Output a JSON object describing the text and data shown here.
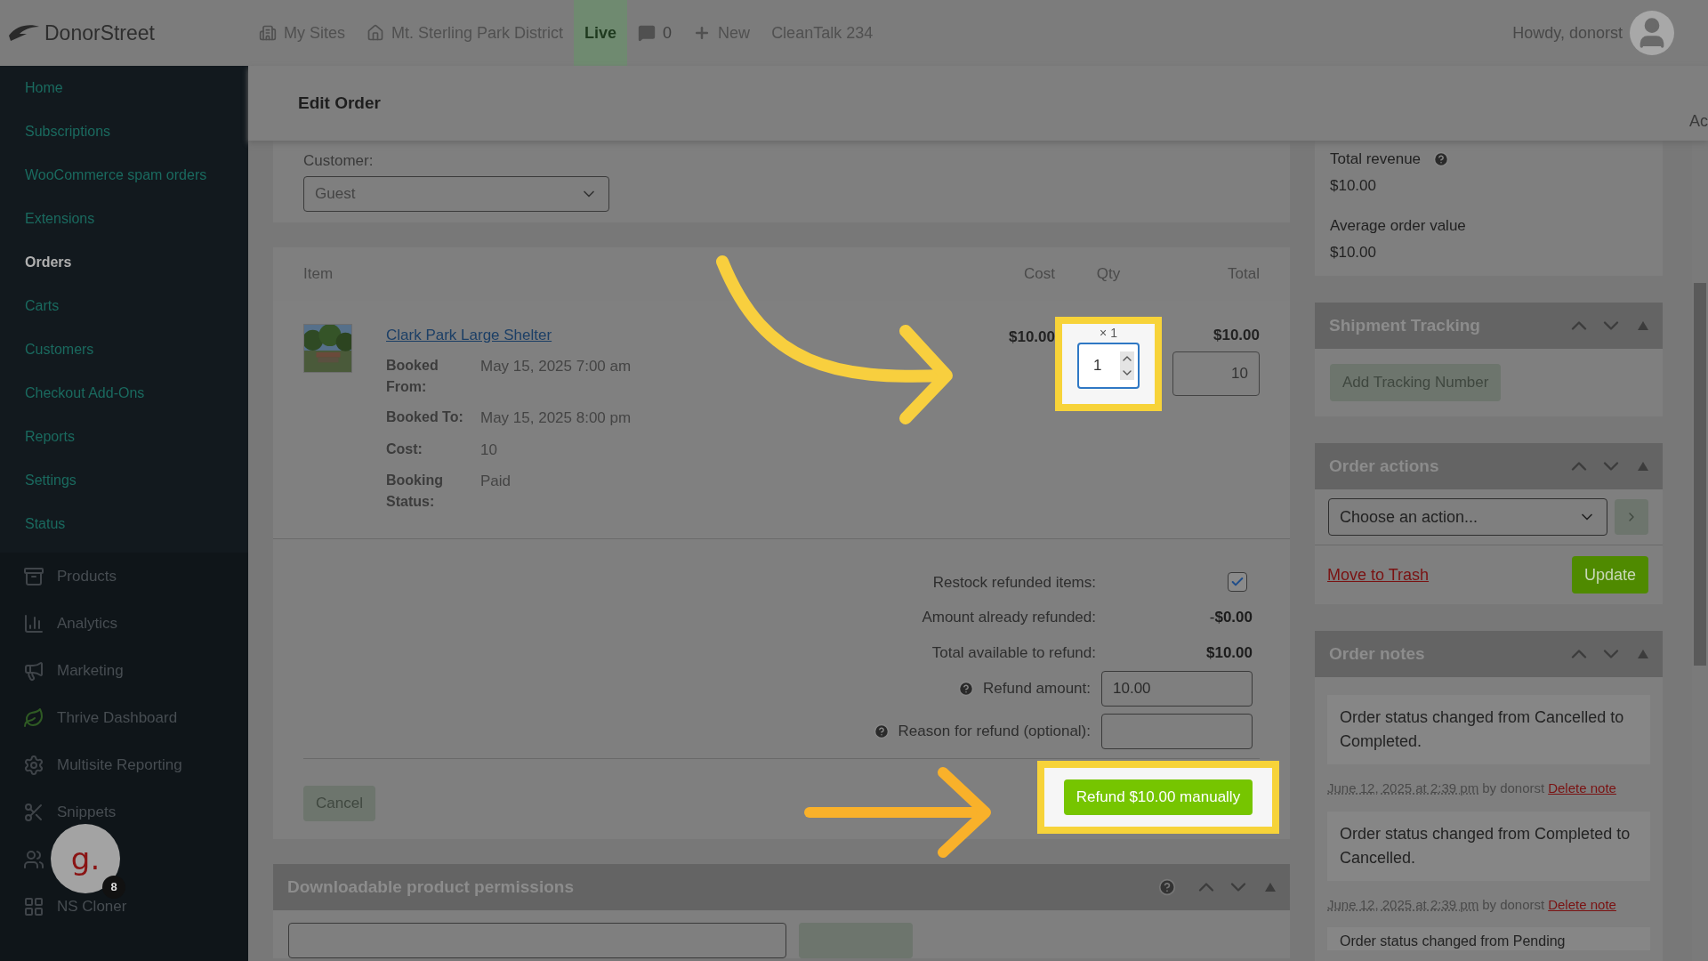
{
  "topbar": {
    "logo": "DonorStreet",
    "items": [
      {
        "kind": "sites",
        "label": "My Sites"
      },
      {
        "kind": "home",
        "label": "Mt. Sterling Park District"
      },
      {
        "kind": "badge",
        "label": "Live"
      },
      {
        "kind": "comments",
        "label": "0"
      },
      {
        "kind": "new",
        "label": "New"
      },
      {
        "kind": "text",
        "label": "CleanTalk 234"
      }
    ],
    "greeting": "Howdy, donorst"
  },
  "sidebar": {
    "submenu": [
      {
        "label": "Home",
        "selected": false
      },
      {
        "label": "Subscriptions",
        "selected": false
      },
      {
        "label": "WooCommerce spam orders",
        "selected": false
      },
      {
        "label": "Extensions",
        "selected": false
      },
      {
        "label": "Orders",
        "selected": true
      },
      {
        "label": "Carts",
        "selected": false
      },
      {
        "label": "Customers",
        "selected": false
      },
      {
        "label": "Checkout Add-Ons",
        "selected": false
      },
      {
        "label": "Reports",
        "selected": false
      },
      {
        "label": "Settings",
        "selected": false
      },
      {
        "label": "Status",
        "selected": false
      }
    ],
    "menu": [
      {
        "kind": "products",
        "label": "Products"
      },
      {
        "kind": "analytics",
        "label": "Analytics"
      },
      {
        "kind": "marketing",
        "label": "Marketing"
      },
      {
        "kind": "thrive",
        "label": "Thrive Dashboard"
      },
      {
        "kind": "gear",
        "label": "Multisite Reporting"
      },
      {
        "kind": "snippets",
        "label": "Snippets"
      },
      {
        "kind": "users"
      },
      {
        "kind": "cloner",
        "label": "NS Cloner"
      }
    ]
  },
  "header": {
    "title": "Edit Order",
    "edge_text": "Ac"
  },
  "customer": {
    "label": "Customer:",
    "value": "Guest"
  },
  "items": {
    "columns": [
      "Item",
      "Cost",
      "Qty",
      "Total"
    ],
    "rows": [
      {
        "name": "Clark Park Large Shelter",
        "meta": [
          {
            "label": "Booked From:",
            "value": "May 15, 2025 7:00 am"
          },
          {
            "label": "Booked To:",
            "value": "May 15, 2025 8:00 pm"
          },
          {
            "label": "Cost:",
            "value": "10"
          },
          {
            "label": "Booking Status:",
            "value": "Paid"
          }
        ],
        "cost": "$10.00",
        "qty_label": "× 1",
        "qty_value": "1",
        "total": "$10.00",
        "total_value": "10"
      }
    ]
  },
  "refund": {
    "restock": {
      "label": "Restock refunded items:",
      "checked": true
    },
    "already": {
      "label": "Amount already refunded:",
      "value": "-**$0.00**"
    },
    "available": {
      "label": "Total available to refund:",
      "value": "$10.00"
    },
    "amount": {
      "label": "Refund amount:",
      "value": "10.00"
    },
    "reason": {
      "label": "Reason for refund (optional):"
    },
    "cancel": "Cancel",
    "refund_button": "Refund $10.00 manually"
  },
  "downloads": {
    "title": "Downloadable product permissions"
  },
  "stats": [
    {
      "label": "Total revenue",
      "value": "$10.00",
      "help": true
    },
    {
      "label": "Average order value",
      "value": "$10.00",
      "help": false
    }
  ],
  "shipment": {
    "title": "Shipment Tracking",
    "button": "Add Tracking Number"
  },
  "actions": {
    "title": "Order actions",
    "select": "Choose an action...",
    "trash": "Move to Trash",
    "update": "Update"
  },
  "notes": {
    "title": "Order notes",
    "items": [
      {
        "text": "Order status changed from Cancelled to Completed.",
        "date": "June 12, 2025 at 2:39 pm",
        "by": "by donorst",
        "delete": "Delete note"
      },
      {
        "text": "Order status changed from Completed to Cancelled.",
        "date": "June 12, 2025 at 2:39 pm",
        "by": "by donorst",
        "delete": "Delete note"
      },
      {
        "text": "Order status changed from Pending"
      }
    ]
  },
  "chat_badge": {
    "letter": "g.",
    "count": "8"
  }
}
